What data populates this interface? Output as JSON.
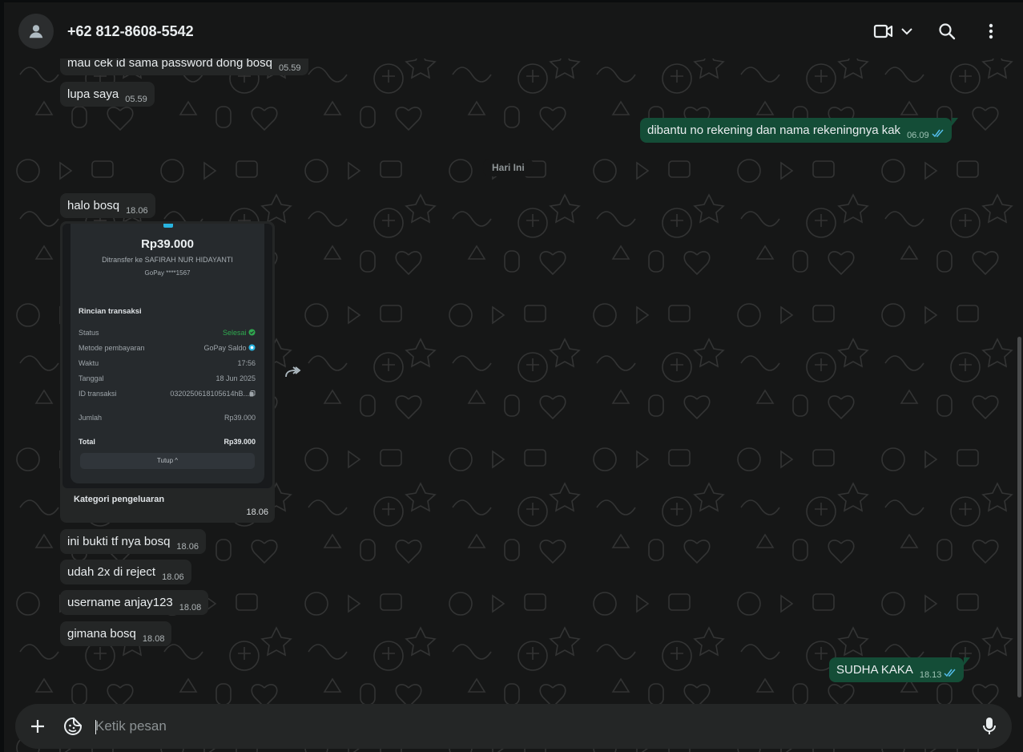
{
  "chat": {
    "contact_name": "+62 812-8608-5542",
    "date_divider": "Hari Ini"
  },
  "messages": [
    {
      "text": "mau cek id sama password dong bosq",
      "time": "05.59",
      "dir": "in"
    },
    {
      "text": "lupa saya",
      "time": "05.59",
      "dir": "in"
    },
    {
      "text": "dibantu no rekening dan nama rekeningnya kak",
      "time": "06.09",
      "dir": "out",
      "status": "read"
    },
    {
      "text": "halo bosq",
      "time": "18.06",
      "dir": "in"
    },
    {
      "text": "ini bukti tf nya bosq",
      "time": "18.06",
      "dir": "in"
    },
    {
      "text": "udah 2x di reject",
      "time": "18.06",
      "dir": "in"
    },
    {
      "text": "username anjay123",
      "time": "18.08",
      "dir": "in"
    },
    {
      "text": "gimana bosq",
      "time": "18.08",
      "dir": "in"
    },
    {
      "text": "SUDHA KAKA",
      "time": "18.13",
      "dir": "out",
      "status": "read"
    }
  ],
  "image_message": {
    "time": "18.06",
    "receipt": {
      "amount": "Rp39.000",
      "transfer_to": "Ditransfer ke SAFIRAH NUR HIDAYANTI",
      "account": "GoPay ****1567",
      "section_title": "Rincian transaksi",
      "rows": [
        {
          "label": "Status",
          "value": "Selesai"
        },
        {
          "label": "Metode pembayaran",
          "value": "GoPay Saldo"
        },
        {
          "label": "Waktu",
          "value": "17:56"
        },
        {
          "label": "Tanggal",
          "value": "18 Jun 2025"
        },
        {
          "label": "ID transaksi",
          "value": "0320250618105614hB..."
        },
        {
          "label": "Jumlah",
          "value": "Rp39.000"
        },
        {
          "label": "Total",
          "value": "Rp39.000"
        }
      ],
      "close_label": "Tutup ^",
      "footer_label": "Kategori pengeluaran"
    }
  },
  "composer": {
    "placeholder": "Ketik pesan"
  },
  "icons": {
    "avatar": "default-avatar-icon",
    "video_call": "video-camera-icon",
    "dropdown": "chevron-down-icon",
    "search": "search-icon",
    "menu": "more-vertical-icon",
    "forward": "forward-icon",
    "attach": "plus-icon",
    "sticker": "sticker-icon",
    "microphone": "microphone-icon"
  },
  "colors": {
    "background": "#161717",
    "incoming_bubble": "#242626",
    "outgoing_bubble": "#144d37",
    "read_ticks": "#53bdeb",
    "status_ok": "#2fa84f"
  }
}
